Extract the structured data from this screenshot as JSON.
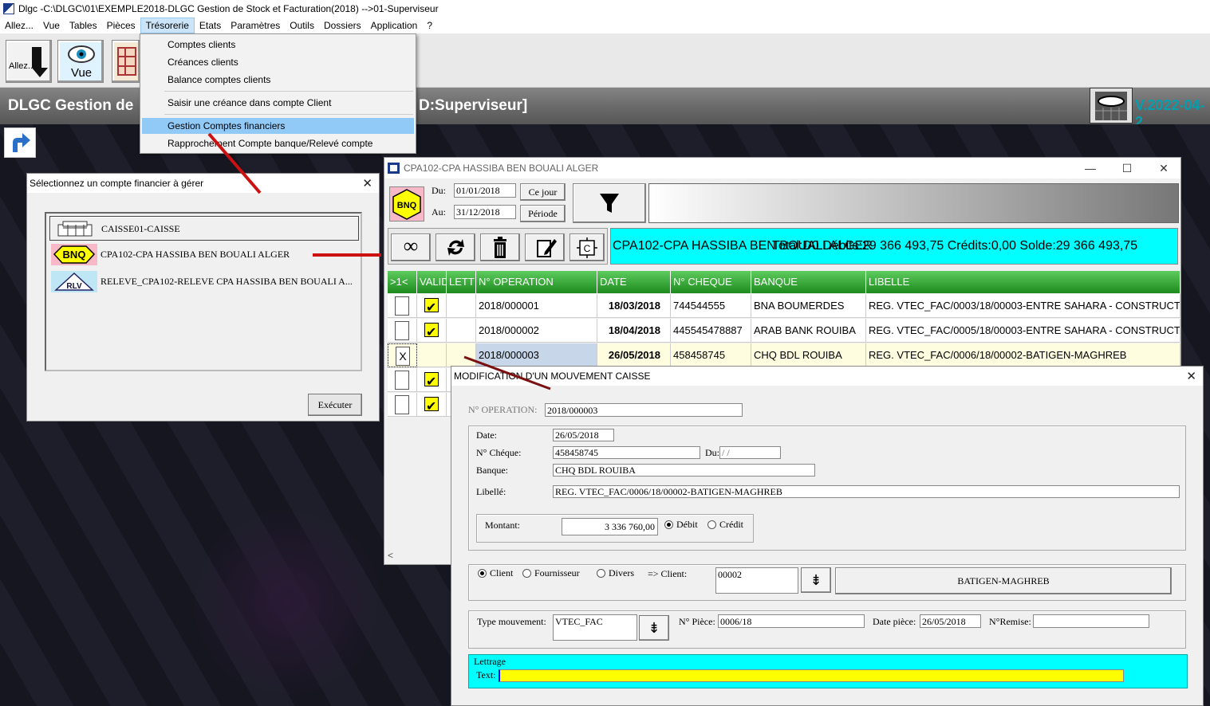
{
  "window": {
    "title": "Dlgc -C:\\DLGC\\01\\EXEMPLE2018-DLGC Gestion de Stock et Facturation(2018) -->01-Superviseur"
  },
  "menubar": {
    "items": [
      "Allez...",
      "Vue",
      "Tables",
      "Pièces",
      "Trésorerie",
      "Etats",
      "Paramètres",
      "Outils",
      "Dossiers",
      "Application",
      "?"
    ]
  },
  "toolbar": {
    "allez_label": "Allez...",
    "vue_label": "Vue"
  },
  "banner": {
    "left_text": "DLGC Gestion de",
    "right_text": "D:Superviseur]",
    "version": "V.2022-04-2"
  },
  "tresorerie_menu": {
    "items": [
      "Comptes clients",
      "Créances clients",
      "Balance comptes clients",
      "Saisir une créance dans compte Client",
      "Gestion Comptes financiers",
      "Rapprochement Compte banque/Relevé compte"
    ]
  },
  "select_dialog": {
    "title": "Sélectionnez un compte financier à gérer",
    "accounts": [
      {
        "icon": "caisse-icon",
        "label": "CAISSE01-CAISSE"
      },
      {
        "icon": "bnq-icon",
        "icon_text": "BNQ",
        "label": "CPA102-CPA HASSIBA BEN BOUALI ALGER"
      },
      {
        "icon": "rlv-icon",
        "icon_text": "RLV",
        "label": "RELEVE_CPA102-RELEVE CPA HASSIBA BEN BOUALI A..."
      }
    ],
    "execute_label": "Exécuter"
  },
  "account_window": {
    "title": "CPA102-CPA HASSIBA BEN BOUALI ALGER",
    "bnq_text": "BNQ",
    "du_label": "Du:",
    "du_value": "01/01/2018",
    "au_label": "Au:",
    "au_value": "31/12/2018",
    "ce_jour_label": "Ce jour",
    "periode_label": "Période",
    "summary": "CPA102-CPA HASSIBA BEN BOUALI ALGER",
    "totals": "Total:D0 Débits:29 366 493,75  Crédits:0,00  Solde:29 366 493,75",
    "columns": [
      ">1<",
      "VALID",
      "LETT",
      "N° OPERATION",
      "DATE",
      "N° CHEQUE",
      "BANQUE",
      "LIBELLE"
    ],
    "rows": [
      {
        "sel": "",
        "valid": true,
        "op": "2018/000001",
        "date": "18/03/2018",
        "cheque": "744544555",
        "banque": "BNA BOUMERDES",
        "libelle": "REG. VTEC_FAC/0003/18/00003-ENTRE SAHARA - CONSTRUCTI"
      },
      {
        "sel": "",
        "valid": true,
        "op": "2018/000002",
        "date": "18/04/2018",
        "cheque": "445545478887",
        "banque": "ARAB BANK ROUIBA",
        "libelle": "REG. VTEC_FAC/0005/18/00003-ENTRE SAHARA - CONSTRUCTI"
      },
      {
        "sel": "X",
        "valid": false,
        "op": "2018/000003",
        "date": "26/05/2018",
        "cheque": "458458745",
        "banque": "CHQ BDL ROUIBA",
        "libelle": "REG. VTEC_FAC/0006/18/00002-BATIGEN-MAGHREB"
      },
      {
        "sel": "",
        "valid": true
      },
      {
        "sel": "",
        "valid": true
      }
    ],
    "scroll_left": "<"
  },
  "modif_dialog": {
    "title": "MODIFICATION D'UN MOUVEMENT CAISSE",
    "op_label": "N° OPERATION:",
    "op_value": "2018/000003",
    "date_label": "Date:",
    "date_value": "26/05/2018",
    "cheque_label": "N° Chéque:",
    "cheque_value": "458458745",
    "du_label": "Du:",
    "du_value": "/ /",
    "banque_label": "Banque:",
    "banque_value": "CHQ BDL ROUIBA",
    "libelle_label": "Libellé:",
    "libelle_value": "REG. VTEC_FAC/0006/18/00002-BATIGEN-MAGHREB",
    "montant_label": "Montant:",
    "montant_value": "3 336 760,00",
    "debit_label": "Débit",
    "credit_label": "Crédit",
    "client_label": "Client",
    "fournisseur_label": "Fournisseur",
    "divers_label": "Divers",
    "arrow_client_label": "=> Client:",
    "client_code": "00002",
    "client_name": "BATIGEN-MAGHREB",
    "type_mvt_label": "Type mouvement:",
    "type_mvt_value": "VTEC_FAC",
    "piece_label": "N° Pièce:",
    "piece_value": "0006/18",
    "date_piece_label": "Date pièce:",
    "date_piece_value": "26/05/2018",
    "remise_label": "N°Remise:",
    "remise_value": "",
    "lettrage_label": "Lettrage",
    "text_label": "Text:"
  },
  "colors": {
    "grid_header": "#2e9e2e",
    "highlight_menu": "#91c9f7",
    "summary_bg": "#00ffff",
    "lettrage_bg": "#00ffff",
    "text_field": "#ffff00",
    "arrow": "#cc1111"
  }
}
